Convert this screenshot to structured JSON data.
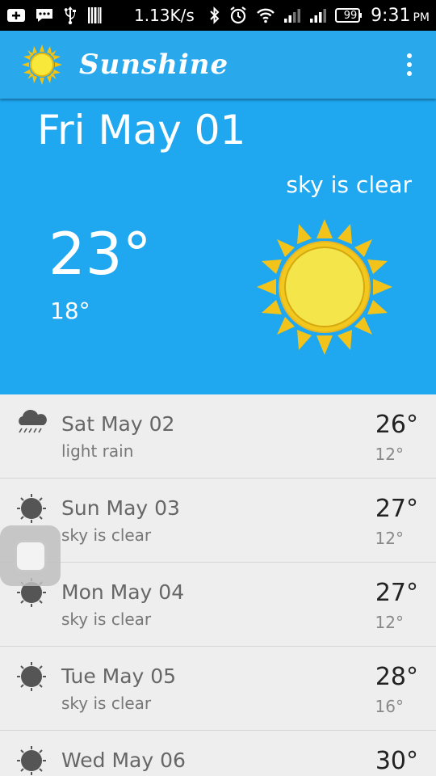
{
  "status_bar": {
    "speed": "1.13K/s",
    "battery": "99",
    "time": "9:31",
    "ampm": "PM",
    "icons": [
      "add-box-icon",
      "chat-icon",
      "usb-icon",
      "barcode-icon",
      "bluetooth-icon",
      "alarm-icon",
      "wifi-icon",
      "signal-icon",
      "signal-2-icon",
      "battery-icon"
    ]
  },
  "appbar": {
    "title": "Sunshine",
    "menu_icon": "overflow-menu-icon",
    "color": "#29a8ec"
  },
  "today": {
    "date": "Fri May 01",
    "description": "sky is clear",
    "high": "23°",
    "low": "18°",
    "icon": "sun-icon",
    "color": "#1fa7f0"
  },
  "forecast": [
    {
      "date": "Sat May 02",
      "description": "light rain",
      "high": "26°",
      "low": "12°",
      "icon": "rain-cloud-icon"
    },
    {
      "date": "Sun May 03",
      "description": "sky is clear",
      "high": "27°",
      "low": "12°",
      "icon": "clear-sun-icon"
    },
    {
      "date": "Mon May 04",
      "description": "sky is clear",
      "high": "27°",
      "low": "12°",
      "icon": "clear-sun-icon"
    },
    {
      "date": "Tue May 05",
      "description": "sky is clear",
      "high": "28°",
      "low": "16°",
      "icon": "clear-sun-icon"
    },
    {
      "date": "Wed May 06",
      "description": "",
      "high": "30°",
      "low": "",
      "icon": "clear-sun-icon"
    }
  ]
}
